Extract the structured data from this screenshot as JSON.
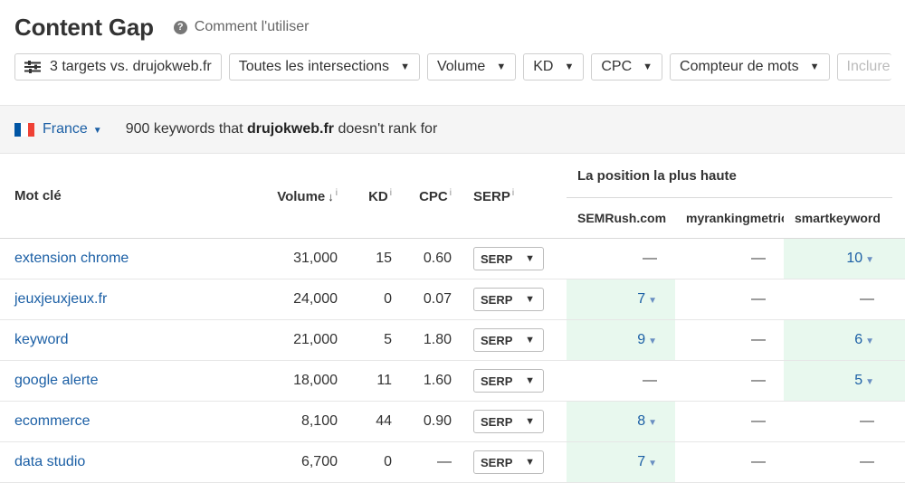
{
  "header": {
    "title": "Content Gap",
    "help_label": "Comment l'utiliser"
  },
  "toolbar": {
    "targets_label": "3 targets vs. drujokweb.fr",
    "intersections_label": "Toutes les intersections",
    "volume_label": "Volume",
    "kd_label": "KD",
    "cpc_label": "CPC",
    "word_count_label": "Compteur de mots",
    "include_placeholder": "Inclure"
  },
  "infobar": {
    "country": "France",
    "summary_prefix": "900 keywords that",
    "domain": "drujokweb.fr",
    "summary_suffix": "doesn't rank for"
  },
  "table": {
    "headers": {
      "keyword": "Mot clé",
      "volume": "Volume",
      "kd": "KD",
      "cpc": "CPC",
      "serp": "SERP",
      "info_mark": "i",
      "sort_arrow": "↓",
      "position_group": "La position la plus haute"
    },
    "competitors": [
      "SEMRush.com",
      "myrankingmetric",
      "smartkeyword"
    ],
    "serp_button_label": "SERP",
    "rows": [
      {
        "keyword": "extension chrome",
        "volume": "31,000",
        "kd": "15",
        "cpc": "0.60",
        "positions": [
          "—",
          "—",
          "10"
        ]
      },
      {
        "keyword": "jeuxjeuxjeux.fr",
        "volume": "24,000",
        "kd": "0",
        "cpc": "0.07",
        "positions": [
          "7",
          "—",
          "—"
        ]
      },
      {
        "keyword": "keyword",
        "volume": "21,000",
        "kd": "5",
        "cpc": "1.80",
        "positions": [
          "9",
          "—",
          "6"
        ]
      },
      {
        "keyword": "google alerte",
        "volume": "18,000",
        "kd": "11",
        "cpc": "1.60",
        "positions": [
          "—",
          "—",
          "5"
        ]
      },
      {
        "keyword": "ecommerce",
        "volume": "8,100",
        "kd": "44",
        "cpc": "0.90",
        "positions": [
          "8",
          "—",
          "—"
        ]
      },
      {
        "keyword": "data studio",
        "volume": "6,700",
        "kd": "0",
        "cpc": "—",
        "positions": [
          "7",
          "—",
          "—"
        ]
      }
    ]
  },
  "colors": {
    "link": "#1b5fa5",
    "highlight": "#e8f8ee",
    "flag_blue": "#0055a4",
    "flag_white": "#ffffff",
    "flag_red": "#ef4135"
  }
}
